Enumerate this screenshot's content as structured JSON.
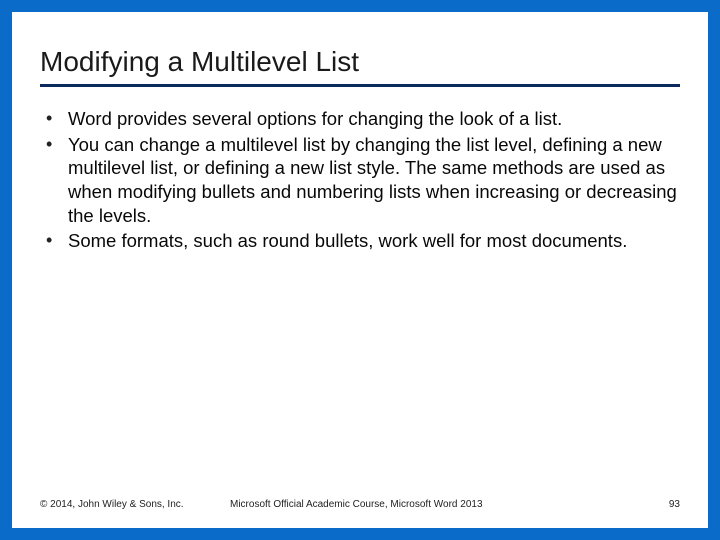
{
  "title": "Modifying a Multilevel List",
  "bullets": [
    "Word provides several options for changing the look of a list.",
    "You can change a multilevel list by changing the list level, defining a new multilevel list, or defining a new list style. The same methods are used as when modifying bullets and numbering lists when increasing or decreasing the levels.",
    "Some formats, such as round bullets, work well for most documents."
  ],
  "footer": {
    "copyright": "© 2014, John Wiley & Sons, Inc.",
    "course": "Microsoft Official Academic Course, Microsoft Word 2013",
    "page": "93"
  }
}
